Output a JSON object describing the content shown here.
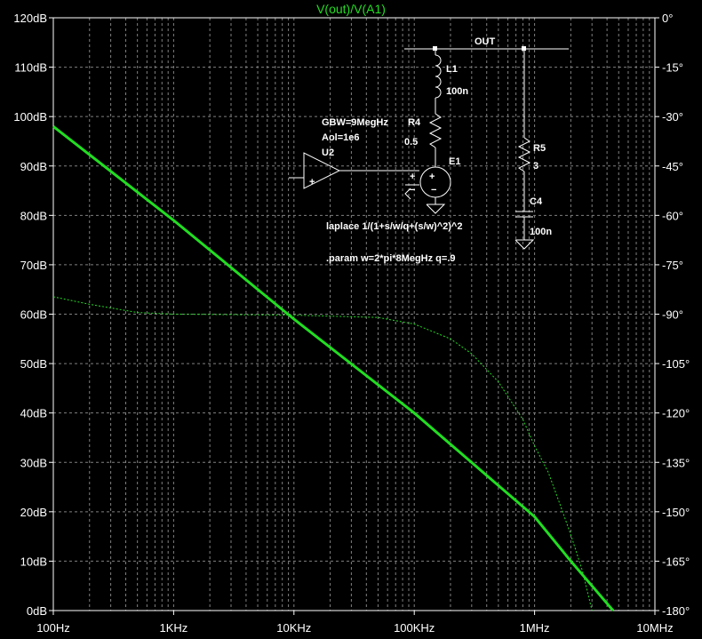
{
  "chart_data": {
    "type": "line",
    "title": "V(out)/V(A1)",
    "x_scale": "log",
    "xlim": [
      100,
      10000000
    ],
    "x_ticks": [
      "100Hz",
      "1KHz",
      "10KHz",
      "100KHz",
      "1MHz",
      "10MHz"
    ],
    "y_left_ticks": [
      "120dB",
      "110dB",
      "100dB",
      "90dB",
      "80dB",
      "70dB",
      "60dB",
      "50dB",
      "40dB",
      "30dB",
      "20dB",
      "10dB",
      "0dB"
    ],
    "y_right_ticks": [
      "0°",
      "-15°",
      "-30°",
      "-45°",
      "-60°",
      "-75°",
      "-90°",
      "-105°",
      "-120°",
      "-135°",
      "-150°",
      "-165°",
      "-180°"
    ],
    "ylim_left": [
      0,
      120
    ],
    "ylim_right": [
      -180,
      0
    ],
    "grid": true,
    "colors": {
      "background": "#000000",
      "grid": "#808080",
      "trace": "#22dd22",
      "text": "#ffffff"
    },
    "series": [
      {
        "axis": "left",
        "style": "solid",
        "x": [
          100,
          1000,
          10000,
          100000,
          1000000,
          2000000,
          3000000,
          4500000
        ],
        "y": [
          98,
          79,
          59,
          40,
          19,
          10,
          5,
          0
        ]
      },
      {
        "axis": "right",
        "style": "dotted",
        "x": [
          100,
          200,
          500,
          1000,
          10000,
          50000,
          100000,
          200000,
          300000,
          500000,
          800000,
          1000000,
          1300000,
          1600000,
          2000000,
          2500000,
          3000000
        ],
        "y": [
          -84.7,
          -87,
          -89.5,
          -90,
          -90.3,
          -91,
          -93,
          -97.5,
          -102,
          -110.5,
          -122,
          -130,
          -138,
          -147,
          -157,
          -168,
          -180
        ]
      }
    ]
  },
  "schematic": {
    "net_label": "OUT",
    "l1_name": "L1",
    "l1_value": "100n",
    "r4_name": "R4",
    "r4_value": "0.5",
    "u2_param": "GBW=9MegHz",
    "u2_aol": "Aol=1e6",
    "u2_name": "U2",
    "e1_name": "E1",
    "r5_name": "R5",
    "r5_value": "3",
    "c4_name": "C4",
    "c4_value": "100n",
    "laplace": "laplace 1/(1+s/w/q+(s/w)^2)^2",
    "param": ".param w=2*pi*8MegHz q=.9"
  }
}
